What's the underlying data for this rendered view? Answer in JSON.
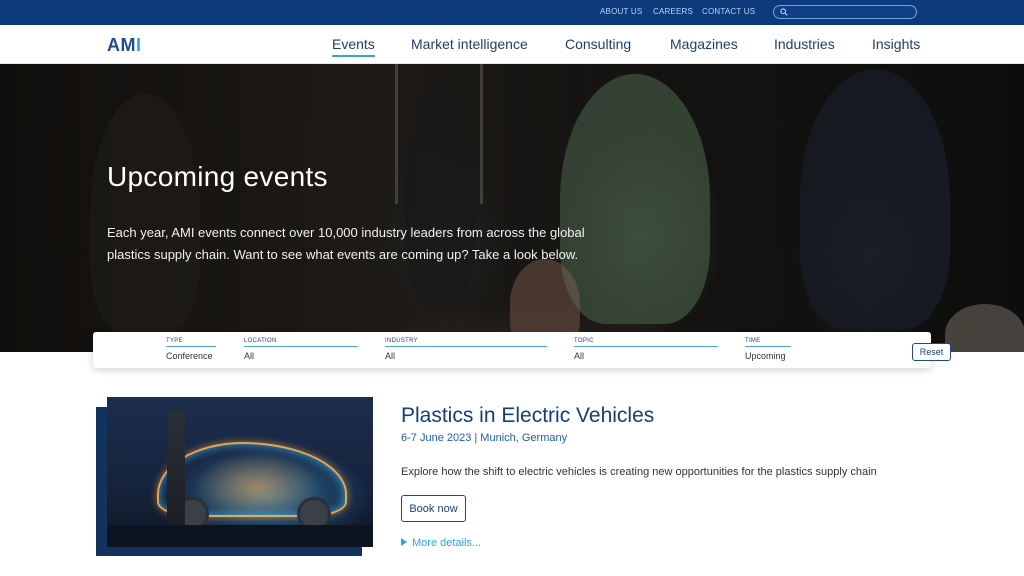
{
  "topbar": {
    "links": [
      "ABOUT US",
      "CAREERS",
      "CONTACT US"
    ],
    "search_placeholder": ""
  },
  "nav": {
    "logo": {
      "a": "AM",
      "i": "I"
    },
    "items": [
      "Events",
      "Market intelligence",
      "Consulting",
      "Magazines",
      "Industries",
      "Insights"
    ],
    "active": "Events"
  },
  "hero": {
    "title": "Upcoming events",
    "text": "Each year, AMI events connect over 10,000 industry leaders from across the global plastics supply chain. Want to see what events are coming up? Take a look below."
  },
  "filters": {
    "type": {
      "label": "TYPE",
      "value": "Conference"
    },
    "location": {
      "label": "LOCATION",
      "value": "All"
    },
    "industry": {
      "label": "INDUSTRY",
      "value": "All"
    },
    "topic": {
      "label": "TOPIC",
      "value": "All"
    },
    "time": {
      "label": "TIME",
      "value": "Upcoming"
    },
    "reset_label": "Reset"
  },
  "event": {
    "title": "Plastics in Electric Vehicles",
    "date": "6-7 June 2023 | Munich, Germany",
    "description": "Explore how the shift to electric vehicles is creating new opportunities for the plastics supply chain",
    "book_label": "Book now",
    "more_label": "More details..."
  },
  "colors": {
    "brand_navy": "#0c3a7a",
    "accent_blue": "#2fa3e0",
    "title_blue": "#123f7a"
  }
}
